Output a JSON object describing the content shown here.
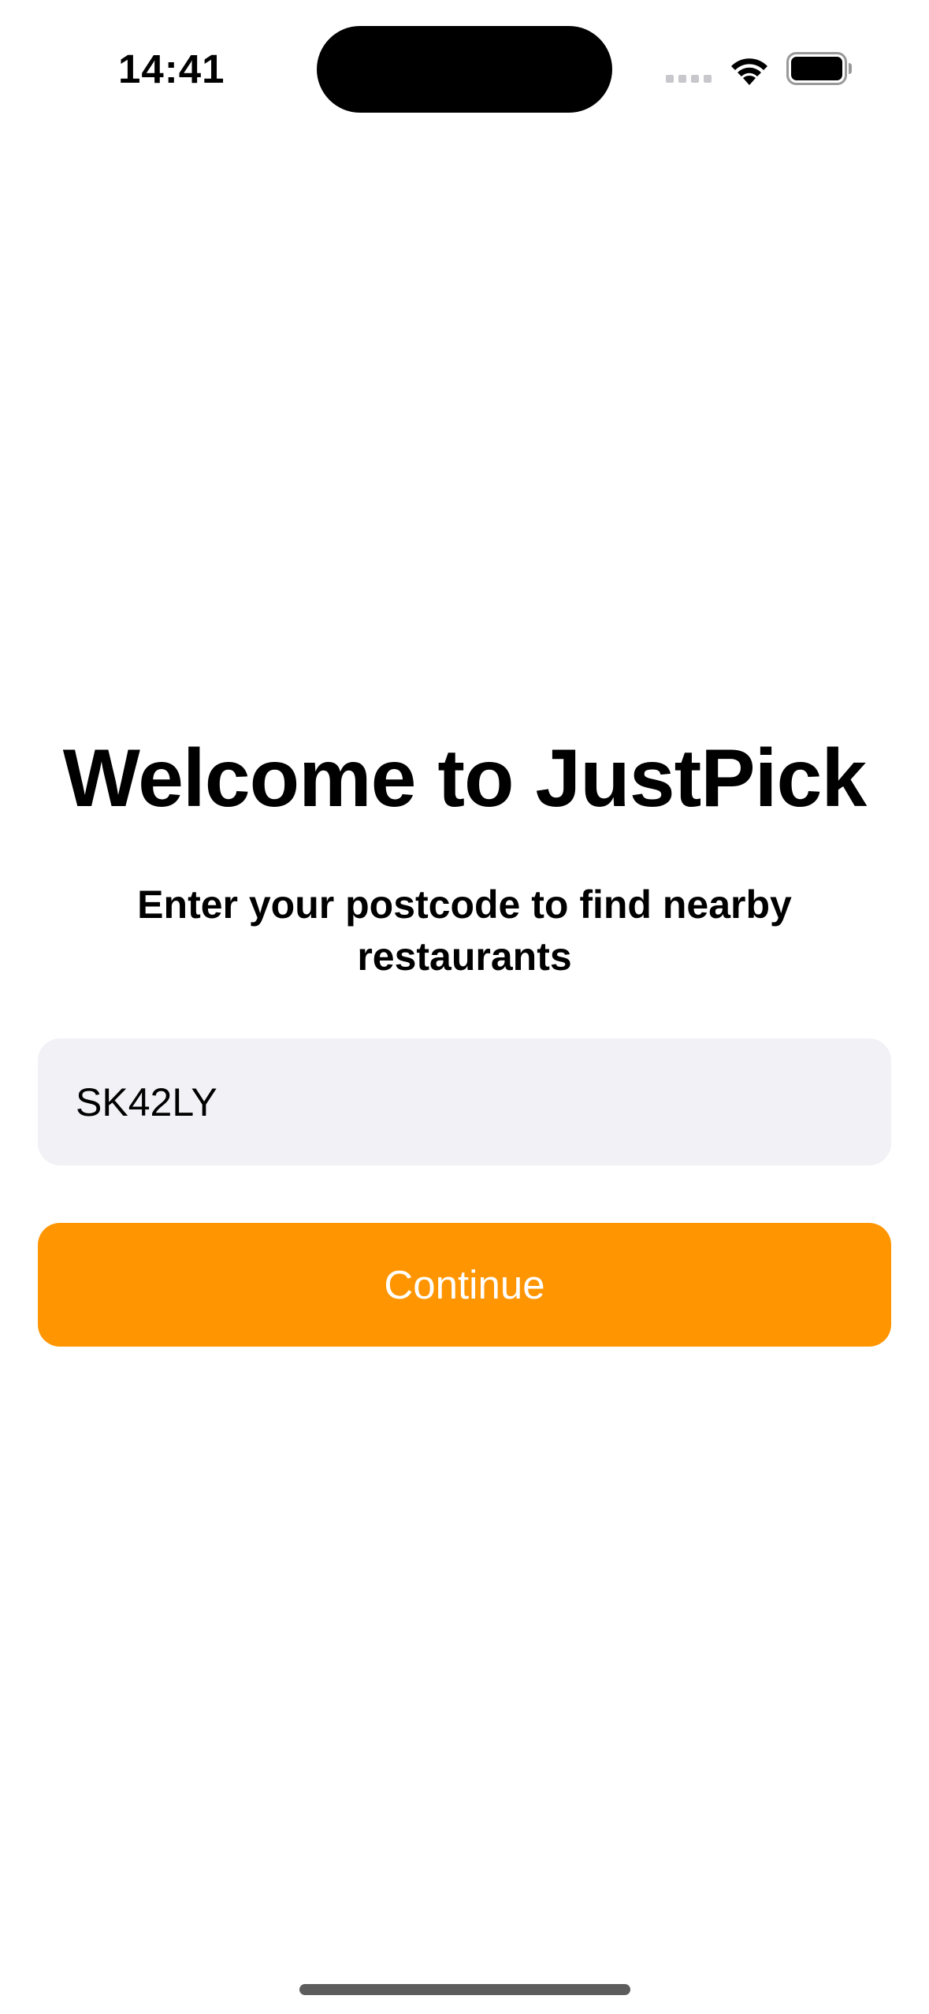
{
  "status_bar": {
    "time": "14:41",
    "icons": [
      "cellular-signal-icon",
      "wifi-icon",
      "battery-icon"
    ]
  },
  "welcome": {
    "title": "Welcome to JustPick",
    "subtitle": "Enter your postcode to find nearby restaurants"
  },
  "postcode_input": {
    "value": "SK42LY"
  },
  "continue_button": {
    "label": "Continue"
  },
  "colors": {
    "accent": "#ff9500",
    "input_background": "#f1f1f6",
    "button_text": "#ffffff"
  }
}
